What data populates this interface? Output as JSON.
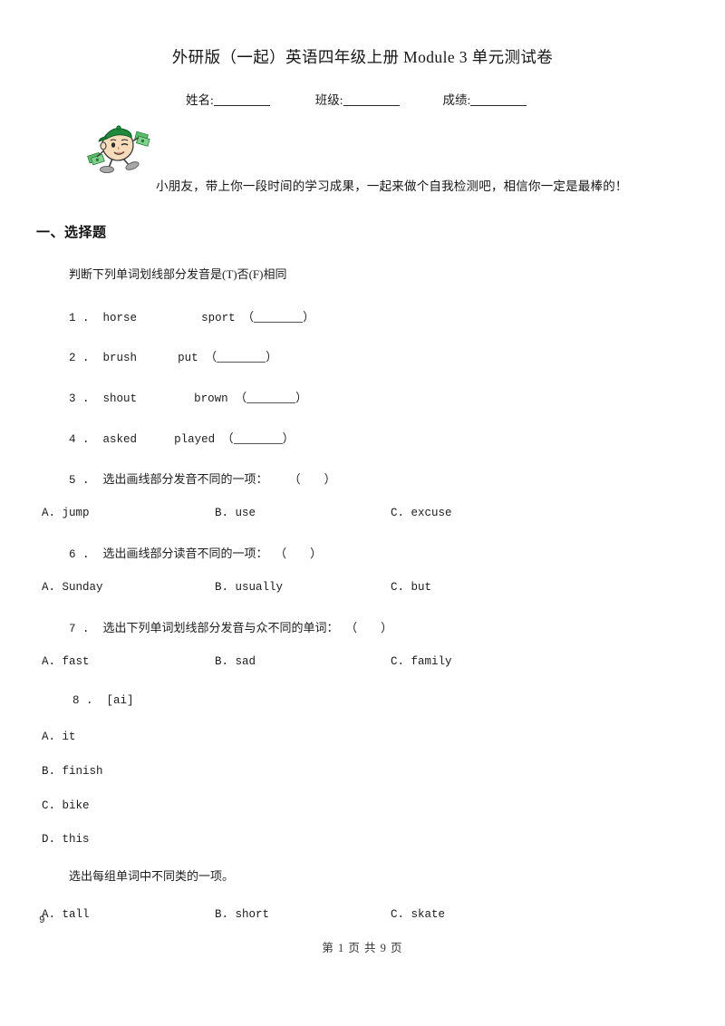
{
  "document": {
    "title": "外研版（一起）英语四年级上册 Module 3 单元测试卷"
  },
  "identity": {
    "name_label": "姓名:",
    "class_label": "班级:",
    "score_label": "成绩:"
  },
  "mascot": {
    "icon_name": "cartoon-boy-with-money-icon",
    "cap_color": "#1f8a3c",
    "skin_color": "#f6d9b6",
    "money_color": "#3fae54",
    "shoe_color": "#9a9a9a"
  },
  "intro": {
    "text": "小朋友，带上你一段时间的学习成果，一起来做个自我检测吧，相信你一定是最棒的！"
  },
  "section": {
    "heading": "一、选择题",
    "instruction_1": "判断下列单词划线部分发音是(T)否(F)相同",
    "instruction_2": "选出每组单词中不同类的一项。"
  },
  "questions": [
    {
      "number": "1 .",
      "word_a": "horse",
      "word_b": "sport",
      "answer_open": "（",
      "answer_close": "）"
    },
    {
      "number": "2 .",
      "word_a": "brush",
      "word_b": "put",
      "answer_open": "（",
      "answer_close": "）"
    },
    {
      "number": "3 .",
      "word_a": "shout",
      "word_b": "brown",
      "answer_open": "（",
      "answer_close": "）"
    },
    {
      "number": "4 .",
      "word_a": "asked",
      "word_b": "played",
      "answer_open": "（",
      "answer_close": "）"
    }
  ],
  "choice_questions": [
    {
      "number": "5 .",
      "prompt": "选出画线部分发音不同的一项：",
      "paren_open": "（",
      "paren_close": "）",
      "options": [
        "A. jump",
        "B. use",
        "C. excuse"
      ]
    },
    {
      "number": "6 .",
      "prompt": "选出画线部分读音不同的一项：",
      "paren_open": "（",
      "paren_close": "）",
      "options": [
        "A. Sunday",
        "B. usually",
        "C. but"
      ]
    },
    {
      "number": "7 .",
      "prompt": "选出下列单词划线部分发音与众不同的单词：",
      "paren_open": "（",
      "paren_close": "）",
      "options": [
        "A. fast",
        "B. sad",
        "C. family"
      ]
    }
  ],
  "question_8": {
    "number": "8 .",
    "prompt": "[ai]",
    "options": [
      "A. it",
      "B. finish",
      "C. bike",
      "D. this"
    ]
  },
  "question_9": {
    "number": "9",
    "options": [
      "A. tall",
      "B. short",
      "C. skate"
    ]
  },
  "footer": {
    "text": "第 1 页 共 9 页"
  }
}
